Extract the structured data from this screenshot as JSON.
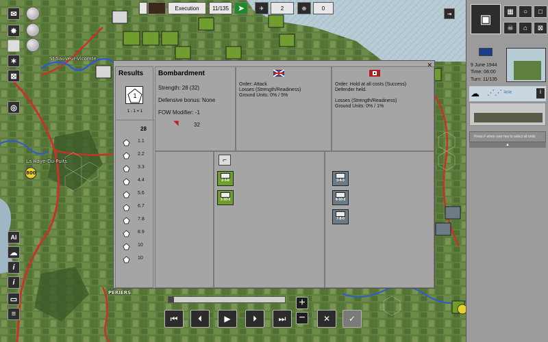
{
  "topbar": {
    "phase": "Execution",
    "turn_counter": "11/135",
    "counter_a": "2",
    "counter_b": "0"
  },
  "map_labels": {
    "st_sauveur": "St Sauveur-Vicomte",
    "la_haye": "La Haye-Du-Puits",
    "periers": "PERIERS",
    "route_number": "800"
  },
  "right_panel": {
    "date": "9 June 1944",
    "time": "Time: 06:00",
    "turn": "Turn: 11/135",
    "hint": "Press F when over hex to select all units"
  },
  "results": {
    "title": "Results",
    "die_value": "1",
    "formula": "1 - 1 = 1",
    "total": "28",
    "rolls": [
      "1.1",
      "2.2",
      "3.3",
      "4.4",
      "5.6",
      "6.7",
      "7.8",
      "8.9",
      "10",
      "10"
    ]
  },
  "bombardment": {
    "title": "Bombardment",
    "strength": "Strength: 28 (32)",
    "defensive_bonus": "Defensive bonus: None",
    "fow_modifier": "FOW Modifier: -1",
    "artillery_value": "32"
  },
  "attacker": {
    "order": "Order: Attack",
    "losses": "Losses (Strength/Readiness)",
    "ground_units": "Ground Units: 0% / 5%"
  },
  "defender": {
    "order": "Order: Hold at all costs (Success)",
    "result": "Defender held.",
    "losses": "Losses (Strength/Readiness)",
    "ground_units": "Ground Units: 0% / 1%"
  },
  "attacker_units": [
    "2-3-8",
    "1-10-2"
  ],
  "defender_units": [
    "3-4-3",
    "4-10-2",
    "7-8-0"
  ],
  "colors": {
    "map_green": "#5b7a3c",
    "dialog_grey": "#a8a8a8",
    "sea_blue": "#a8c4d4",
    "allied_green": "#6f9e2e",
    "axis_grey": "#6c7b86"
  }
}
